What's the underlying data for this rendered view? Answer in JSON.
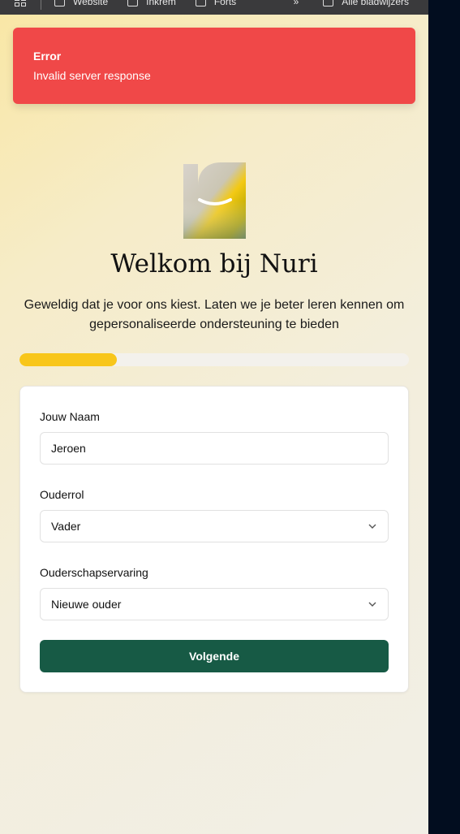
{
  "bookmarks": {
    "items": [
      {
        "label": "Website"
      },
      {
        "label": "Inkrem"
      },
      {
        "label": "Forts"
      }
    ],
    "more_label": "»",
    "last_label": "Alle bladwijzers"
  },
  "toast": {
    "title": "Error",
    "message": "Invalid server response",
    "color": "#f04848"
  },
  "header": {
    "title": "Welkom bij Nuri",
    "subtitle": "Geweldig dat je voor ons kiest. Laten we je beter leren kennen om gepersonaliseerde ondersteuning te bieden"
  },
  "progress": {
    "fraction": 0.25,
    "fill_color": "#f8c61a"
  },
  "form": {
    "name_label": "Jouw Naam",
    "name_value": "Jeroen",
    "role_label": "Ouderrol",
    "role_value": "Vader",
    "experience_label": "Ouderschapservaring",
    "experience_value": "Nieuwe ouder",
    "submit_label": "Volgende",
    "submit_color": "#175a45"
  }
}
